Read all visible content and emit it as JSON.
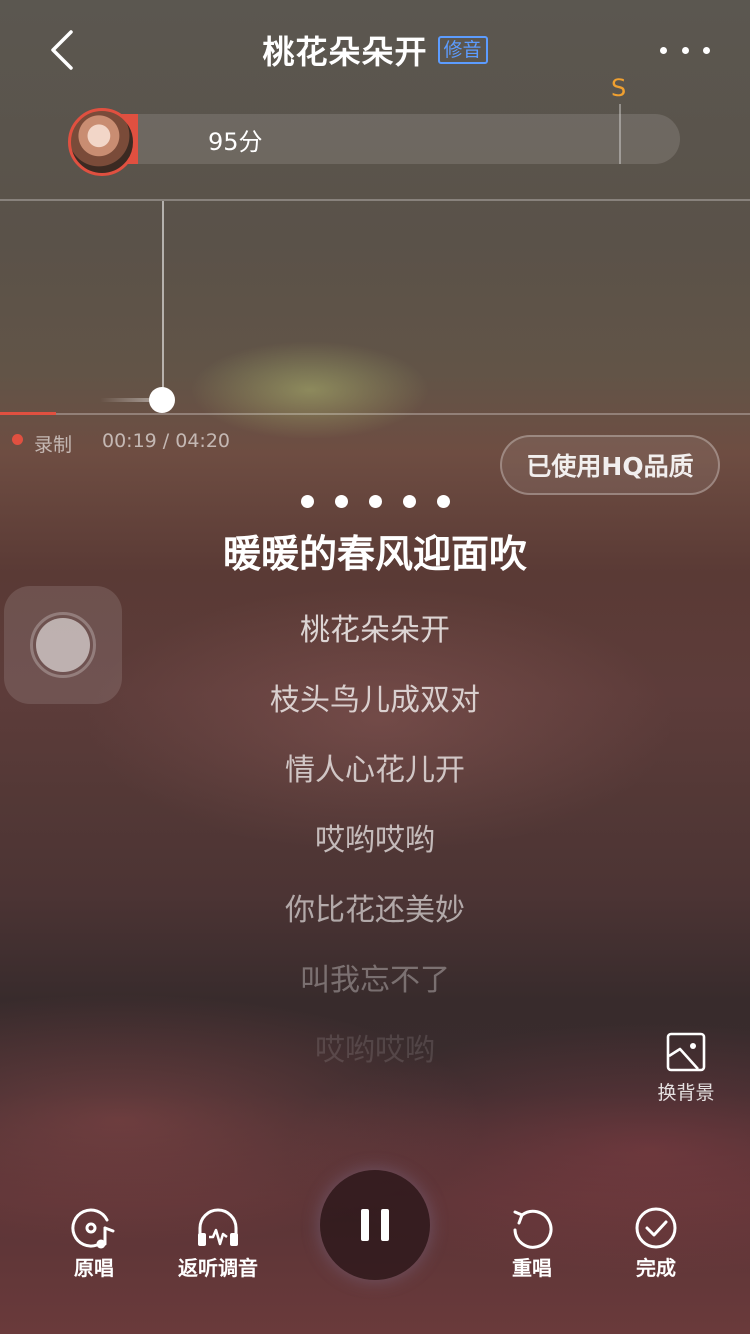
{
  "header": {
    "title": "桃花朵朵开",
    "tag": "修音",
    "back_icon": "chevron-left-icon",
    "more_icon": "more-dots-icon"
  },
  "score": {
    "text": "95分",
    "grade_mark": "S",
    "progress_fraction": 0.05
  },
  "recording": {
    "label": "录制",
    "time": "00:19 / 04:20",
    "progress_fraction": 0.073
  },
  "quality_button": {
    "label": "已使用HQ品质"
  },
  "countdown_dots": 5,
  "lyrics": {
    "current": "暖暖的春风迎面吹",
    "upcoming": [
      "桃花朵朵开",
      "枝头鸟儿成双对",
      "情人心花儿开",
      "哎哟哎哟",
      "你比花还美妙",
      "叫我忘不了",
      "哎哟哎哟"
    ]
  },
  "change_background": {
    "label": "换背景",
    "icon": "image-icon"
  },
  "controls": {
    "original": {
      "label": "原唱",
      "icon": "original-vocal-icon"
    },
    "playback_tune": {
      "label": "返听调音",
      "icon": "headphones-wave-icon"
    },
    "pause": {
      "icon": "pause-icon"
    },
    "restart": {
      "label": "重唱",
      "icon": "restart-icon"
    },
    "finish": {
      "label": "完成",
      "icon": "check-circle-icon"
    }
  },
  "colors": {
    "accent_red": "#e05040",
    "tag_blue": "#5c9cff",
    "grade_orange": "#f0a030"
  }
}
